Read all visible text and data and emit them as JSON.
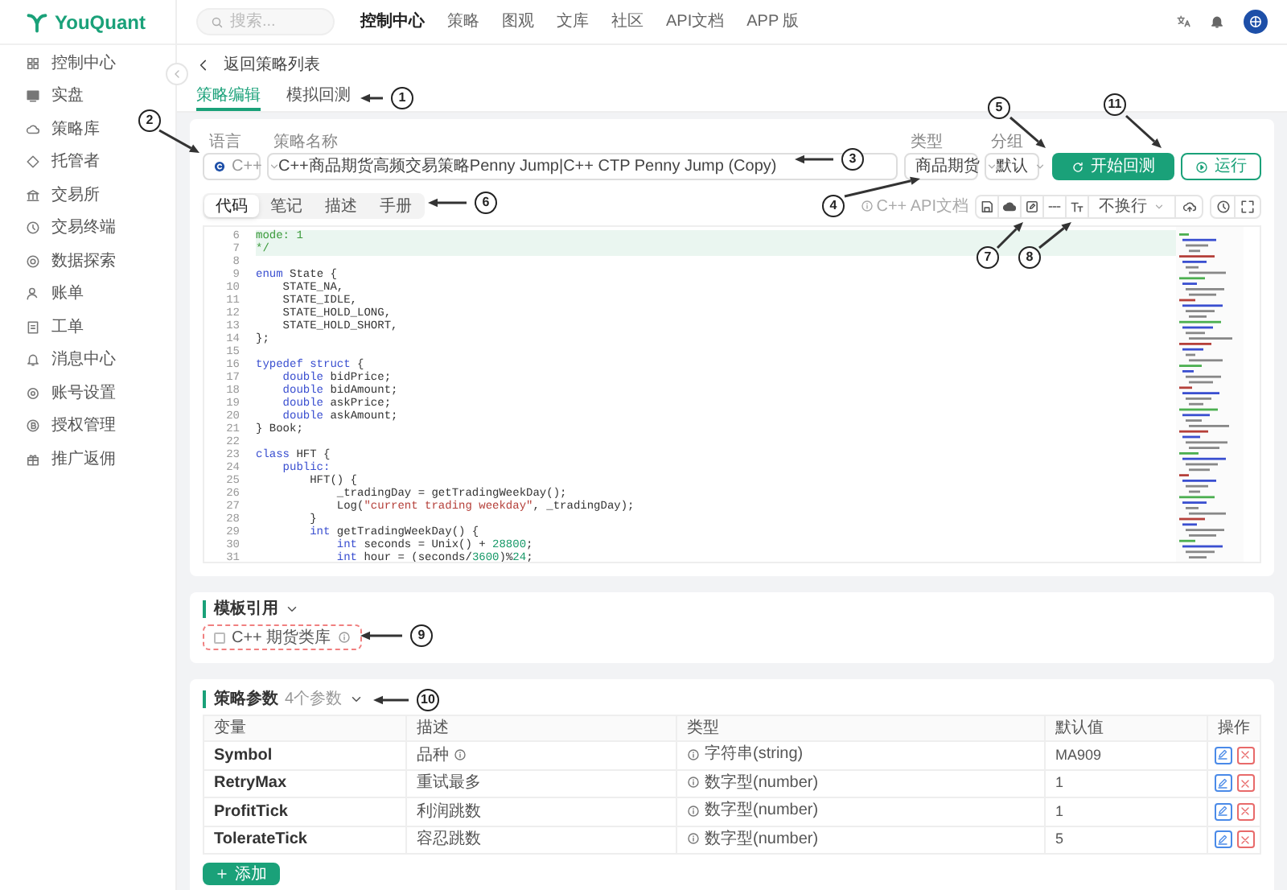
{
  "brand": {
    "name": "YouQuant"
  },
  "sidebar": {
    "items": [
      {
        "label": "控制中心"
      },
      {
        "label": "实盘"
      },
      {
        "label": "策略库"
      },
      {
        "label": "托管者"
      },
      {
        "label": "交易所"
      },
      {
        "label": "交易终端"
      },
      {
        "label": "数据探索"
      },
      {
        "label": "账单"
      },
      {
        "label": "工单"
      },
      {
        "label": "消息中心"
      },
      {
        "label": "账号设置"
      },
      {
        "label": "授权管理"
      },
      {
        "label": "推广返佣"
      }
    ]
  },
  "topbar": {
    "search": {
      "placeholder": "搜索..."
    },
    "nav": [
      {
        "label": "控制中心",
        "selected": true
      },
      {
        "label": "策略",
        "selected": false
      },
      {
        "label": "图观",
        "selected": false
      },
      {
        "label": "文库",
        "selected": false
      },
      {
        "label": "社区",
        "selected": false
      },
      {
        "label": "API文档",
        "selected": false
      },
      {
        "label": "APP 版",
        "selected": false
      }
    ]
  },
  "back_link": "返回策略列表",
  "tabs": [
    {
      "label": "策略编辑",
      "selected": true
    },
    {
      "label": "模拟回测",
      "selected": false
    }
  ],
  "form": {
    "language": {
      "label": "语言",
      "value": "C++",
      "disabled": true
    },
    "name": {
      "label": "策略名称",
      "value": "C++商品期货高频交易策略Penny Jump|C++ CTP Penny Jump (Copy)"
    },
    "type": {
      "label": "类型",
      "value": "商品期货"
    },
    "group": {
      "label": "分组",
      "value": "默认"
    },
    "buttons": [
      {
        "label": "开始回测",
        "kind": "primary"
      },
      {
        "label": "运行",
        "kind": "outline"
      }
    ]
  },
  "editor": {
    "tabs": [
      {
        "label": "代码",
        "selected": true
      },
      {
        "label": "笔记",
        "selected": false
      },
      {
        "label": "描述",
        "selected": false
      },
      {
        "label": "手册",
        "selected": false
      }
    ],
    "api_doc_link": "C++ API文档",
    "wrap_select": "不换行",
    "lines": [
      {
        "no": "6",
        "highlighted": true,
        "segments": [
          {
            "t": "mode: 1",
            "kind": "comment"
          }
        ]
      },
      {
        "no": "7",
        "highlighted": true,
        "segments": [
          {
            "t": "*/",
            "kind": "comment"
          }
        ]
      },
      {
        "no": "8",
        "highlighted": false
      },
      {
        "no": "9",
        "highlighted": false,
        "segments": [
          {
            "t": "enum",
            "kind": "keyword"
          },
          {
            "t": " State {",
            "kind": "plain"
          }
        ]
      },
      {
        "no": "10",
        "highlighted": false,
        "segments": [
          {
            "t": "    STATE_NA,",
            "kind": "plain"
          }
        ]
      },
      {
        "no": "11",
        "highlighted": false,
        "segments": [
          {
            "t": "    STATE_IDLE,",
            "kind": "plain"
          }
        ]
      },
      {
        "no": "12",
        "highlighted": false,
        "segments": [
          {
            "t": "    STATE_HOLD_LONG,",
            "kind": "plain"
          }
        ]
      },
      {
        "no": "13",
        "highlighted": false,
        "segments": [
          {
            "t": "    STATE_HOLD_SHORT,",
            "kind": "plain"
          }
        ]
      },
      {
        "no": "14",
        "highlighted": false,
        "segments": [
          {
            "t": "};",
            "kind": "plain"
          }
        ]
      },
      {
        "no": "15",
        "highlighted": false
      },
      {
        "no": "16",
        "highlighted": false,
        "segments": [
          {
            "t": "typedef struct",
            "kind": "keyword"
          },
          {
            "t": " {",
            "kind": "plain"
          }
        ]
      },
      {
        "no": "17",
        "highlighted": false,
        "segments": [
          {
            "t": "    double",
            "kind": "keyword"
          },
          {
            "t": " bidPrice;",
            "kind": "plain"
          }
        ]
      },
      {
        "no": "18",
        "highlighted": false,
        "segments": [
          {
            "t": "    double",
            "kind": "keyword"
          },
          {
            "t": " bidAmount;",
            "kind": "plain"
          }
        ]
      },
      {
        "no": "19",
        "highlighted": false,
        "segments": [
          {
            "t": "    double",
            "kind": "keyword"
          },
          {
            "t": " askPrice;",
            "kind": "plain"
          }
        ]
      },
      {
        "no": "20",
        "highlighted": false,
        "segments": [
          {
            "t": "    double",
            "kind": "keyword"
          },
          {
            "t": " askAmount;",
            "kind": "plain"
          }
        ]
      },
      {
        "no": "21",
        "highlighted": false,
        "segments": [
          {
            "t": "} Book;",
            "kind": "plain"
          }
        ]
      },
      {
        "no": "22",
        "highlighted": false
      },
      {
        "no": "23",
        "highlighted": false,
        "segments": [
          {
            "t": "class",
            "kind": "keyword"
          },
          {
            "t": " HFT {",
            "kind": "plain"
          }
        ]
      },
      {
        "no": "24",
        "highlighted": false,
        "segments": [
          {
            "t": "    public:",
            "kind": "keyword"
          }
        ]
      },
      {
        "no": "25",
        "highlighted": false,
        "segments": [
          {
            "t": "        HFT() {",
            "kind": "plain"
          }
        ]
      },
      {
        "no": "26",
        "highlighted": false,
        "segments": [
          {
            "t": "            _tradingDay = getTradingWeekDay();",
            "kind": "plain"
          }
        ]
      },
      {
        "no": "27",
        "highlighted": false,
        "segments": [
          {
            "t": "            Log(",
            "kind": "plain"
          },
          {
            "t": "\"current trading weekday\"",
            "kind": "string"
          },
          {
            "t": ", _tradingDay);",
            "kind": "plain"
          }
        ]
      },
      {
        "no": "28",
        "highlighted": false,
        "segments": [
          {
            "t": "        }",
            "kind": "plain"
          }
        ]
      },
      {
        "no": "29",
        "highlighted": false,
        "segments": [
          {
            "t": "        int",
            "kind": "keyword"
          },
          {
            "t": " getTradingWeekDay() {",
            "kind": "plain"
          }
        ]
      },
      {
        "no": "30",
        "highlighted": false,
        "segments": [
          {
            "t": "            int",
            "kind": "keyword"
          },
          {
            "t": " seconds = Unix() + ",
            "kind": "plain"
          },
          {
            "t": "28800",
            "kind": "number"
          },
          {
            "t": ";",
            "kind": "plain"
          }
        ]
      },
      {
        "no": "31",
        "highlighted": false,
        "segments": [
          {
            "t": "            int",
            "kind": "keyword"
          },
          {
            "t": " hour = (seconds/",
            "kind": "plain"
          },
          {
            "t": "3600",
            "kind": "number"
          },
          {
            "t": ")%",
            "kind": "plain"
          },
          {
            "t": "24",
            "kind": "number"
          },
          {
            "t": ";",
            "kind": "plain"
          }
        ]
      }
    ]
  },
  "template_section": {
    "title": "模板引用",
    "expanded": true,
    "items": [
      {
        "label": "C++ 期货类库",
        "checked": false
      }
    ]
  },
  "params_section": {
    "title": "策略参数",
    "count": "4个参数",
    "expanded": true,
    "columns": [
      "变量",
      "描述",
      "类型",
      "默认值",
      "操作"
    ],
    "rows": [
      {
        "variable": "Symbol",
        "description": "品种",
        "description_hint": true,
        "type": "字符串(string)",
        "default": "MA909"
      },
      {
        "variable": "RetryMax",
        "description": "重试最多",
        "description_hint": false,
        "type": "数字型(number)",
        "default": "1"
      },
      {
        "variable": "ProfitTick",
        "description": "利润跳数",
        "description_hint": false,
        "type": "数字型(number)",
        "default": "1"
      },
      {
        "variable": "TolerateTick",
        "description": "容忍跳数",
        "description_hint": false,
        "type": "数字型(number)",
        "default": "5"
      }
    ],
    "add_button": "添加"
  },
  "callouts": [
    {
      "number": "1"
    },
    {
      "number": "2"
    },
    {
      "number": "3"
    },
    {
      "number": "4"
    },
    {
      "number": "5"
    },
    {
      "number": "6"
    },
    {
      "number": "7"
    },
    {
      "number": "8"
    },
    {
      "number": "9"
    },
    {
      "number": "10"
    },
    {
      "number": "11"
    }
  ]
}
